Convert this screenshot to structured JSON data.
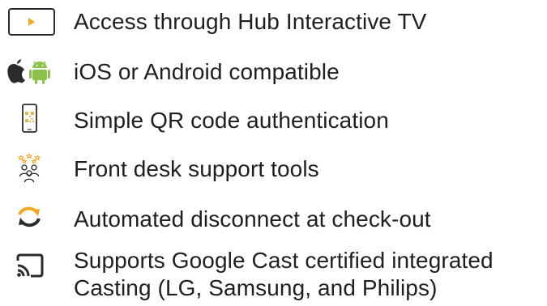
{
  "colors": {
    "text": "#1f1f1f",
    "icon_dark": "#2b2b2b",
    "accent_orange": "#f5a623",
    "android_green": "#8bc34a",
    "qr_yellow": "#e0b84b"
  },
  "features": [
    {
      "icon": "tv-play-icon",
      "label": "Access through Hub Interactive TV"
    },
    {
      "icon": "apple-android-icon",
      "label": "iOS or Android compatible"
    },
    {
      "icon": "phone-qr-icon",
      "label": "Simple QR code authentication"
    },
    {
      "icon": "people-stars-icon",
      "label": "Front desk support tools"
    },
    {
      "icon": "sync-arrows-icon",
      "label": "Automated disconnect at check-out"
    },
    {
      "icon": "cast-icon",
      "label": "Supports Google Cast certified integrated",
      "label_line2": "Casting (LG, Samsung, and Philips)"
    }
  ]
}
